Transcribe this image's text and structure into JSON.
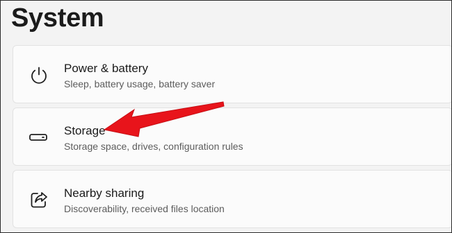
{
  "page": {
    "title": "System"
  },
  "settings": [
    {
      "label": "Power & battery",
      "description": "Sleep, battery usage, battery saver",
      "icon": "power-icon"
    },
    {
      "label": "Storage",
      "description": "Storage space, drives, configuration rules",
      "icon": "storage-drive-icon"
    },
    {
      "label": "Nearby sharing",
      "description": "Discoverability, received files location",
      "icon": "share-icon"
    }
  ],
  "annotation": {
    "arrow_color": "#e8141b",
    "target": "Storage"
  }
}
